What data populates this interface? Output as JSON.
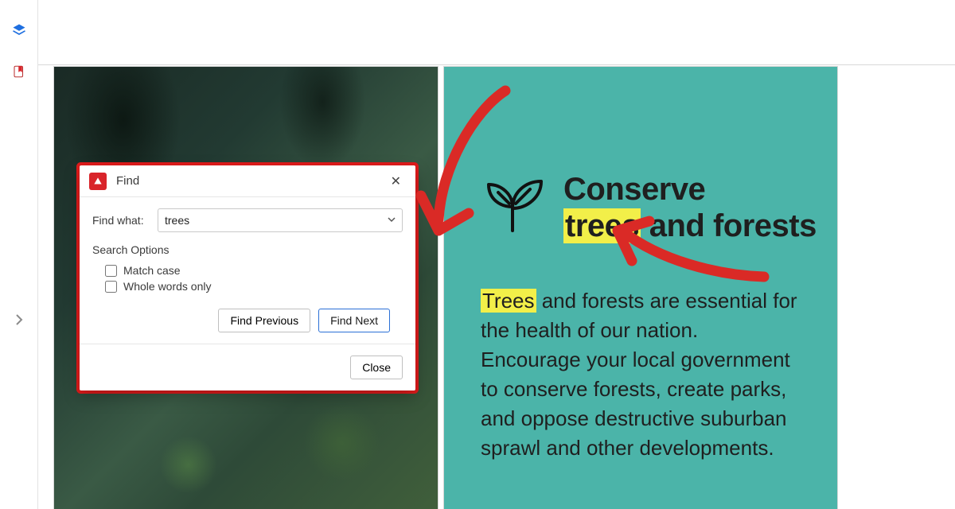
{
  "sidebar": {
    "layers_icon": "layers-icon",
    "bookmark_icon": "bookmark-icon",
    "expand_icon": "chevron-right-icon"
  },
  "find_dialog": {
    "title": "Find",
    "find_what_label": "Find what:",
    "find_what_value": "trees",
    "search_options_label": "Search Options",
    "match_case_label": "Match case",
    "whole_words_label": "Whole words only",
    "find_prev_label": "Find Previous",
    "find_next_label": "Find Next",
    "close_label": "Close"
  },
  "doc": {
    "heading_line1": "Conserve",
    "heading_hl": "trees",
    "heading_line2_rest": " and forests",
    "body_hl": "Trees",
    "body_rest": " and forests are essential for the health of our nation. Encourage your local govern­ment to conserve forests, create parks, and oppose destructive suburban sprawl and other developments."
  }
}
